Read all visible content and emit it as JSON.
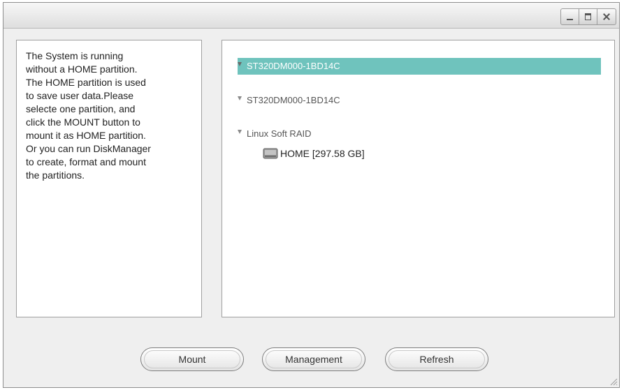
{
  "window": {
    "title": "",
    "controls": {
      "minimize_icon": "minimize-icon",
      "maximize_icon": "maximize-icon",
      "close_icon": "close-icon"
    }
  },
  "info": {
    "lines": [
      "The System is running",
      "without a HOME partition.",
      "The HOME partition is used",
      "to save user data.Please",
      "selecte one partition, and",
      "click the MOUNT button to",
      "mount it as HOME partition.",
      "Or you can run DiskManager",
      "to create, format and mount",
      "the partitions."
    ]
  },
  "tree": {
    "devices": [
      {
        "label": "ST320DM000-1BD14C",
        "selected": true
      },
      {
        "label": "ST320DM000-1BD14C",
        "selected": false
      },
      {
        "label": "Linux Soft RAID",
        "selected": false
      }
    ],
    "partition": {
      "label": "HOME [297.58 GB]",
      "icon": "disk-icon"
    },
    "selected_color": "#6fc3bd"
  },
  "buttons": {
    "mount": "Mount",
    "management": "Management",
    "refresh": "Refresh"
  }
}
